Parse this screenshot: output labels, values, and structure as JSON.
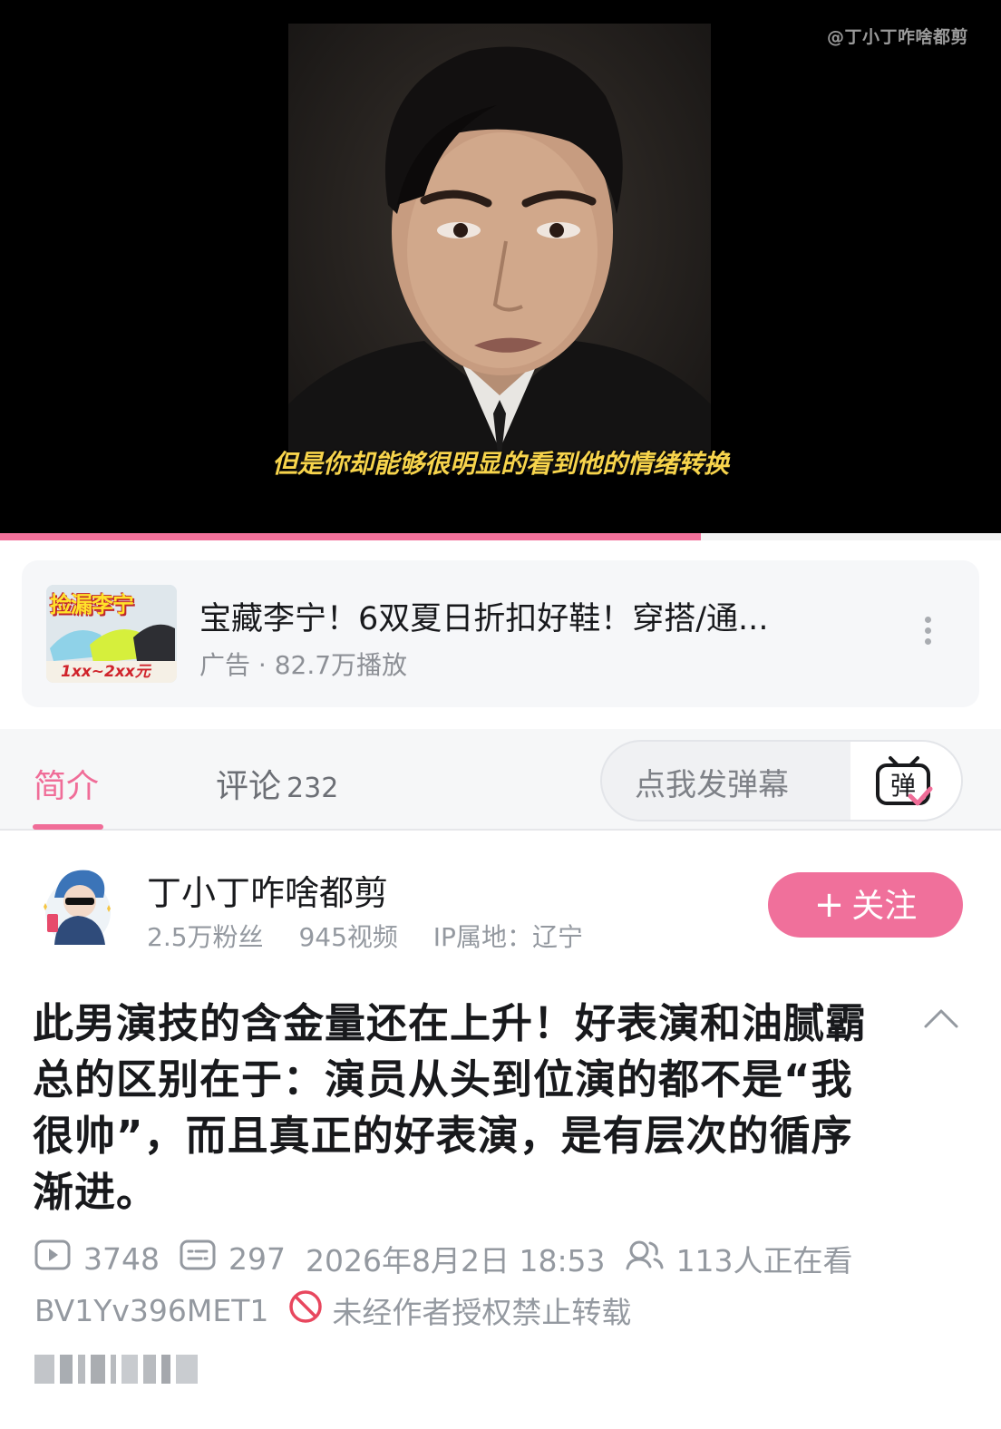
{
  "player": {
    "watermark": "@丁小丁咋啥都剪",
    "subtitle": "但是你却能够很明显的看到他的情绪转换",
    "progress": 0.7,
    "progress_color": "#f2719a"
  },
  "ad": {
    "thumb_title": "捡漏李宁",
    "thumb_price": "1xx~2xx元",
    "title": "宝藏李宁！6双夏日折扣好鞋！穿搭/通...",
    "meta": "广告 · 82.7万播放",
    "more_icon": "more-vertical-icon"
  },
  "tabs": {
    "intro": "简介",
    "comments": "评论",
    "comments_count": "232",
    "active_color": "#f06d98"
  },
  "danmaku": {
    "placeholder": "点我发弹幕",
    "icon_label": "弹"
  },
  "uploader": {
    "name": "丁小丁咋啥都剪",
    "fans": "2.5万粉丝",
    "videos": "945视频",
    "ip": "IP属地：辽宁",
    "follow_label": "关注",
    "follow_plus": "+"
  },
  "video": {
    "title": "此男演技的含金量还在上升！好表演和油腻霸总的区别在于：演员从头到位演的都不是“我很帅”，而且真正的好表演，是有层次的循序渐进。",
    "play_count": "3748",
    "danmaku_count": "297",
    "publish_time": "2026年8月2日 18:53",
    "watching": "113人正在看",
    "bvid": "BV1Yv396MET1",
    "copyright": "未经作者授权禁止转载"
  },
  "icons": {
    "play": "play-count-icon",
    "danmaku": "danmaku-count-icon",
    "viewers": "viewers-icon",
    "forbidden": "forbidden-icon",
    "collapse": "chevron-up-icon"
  }
}
